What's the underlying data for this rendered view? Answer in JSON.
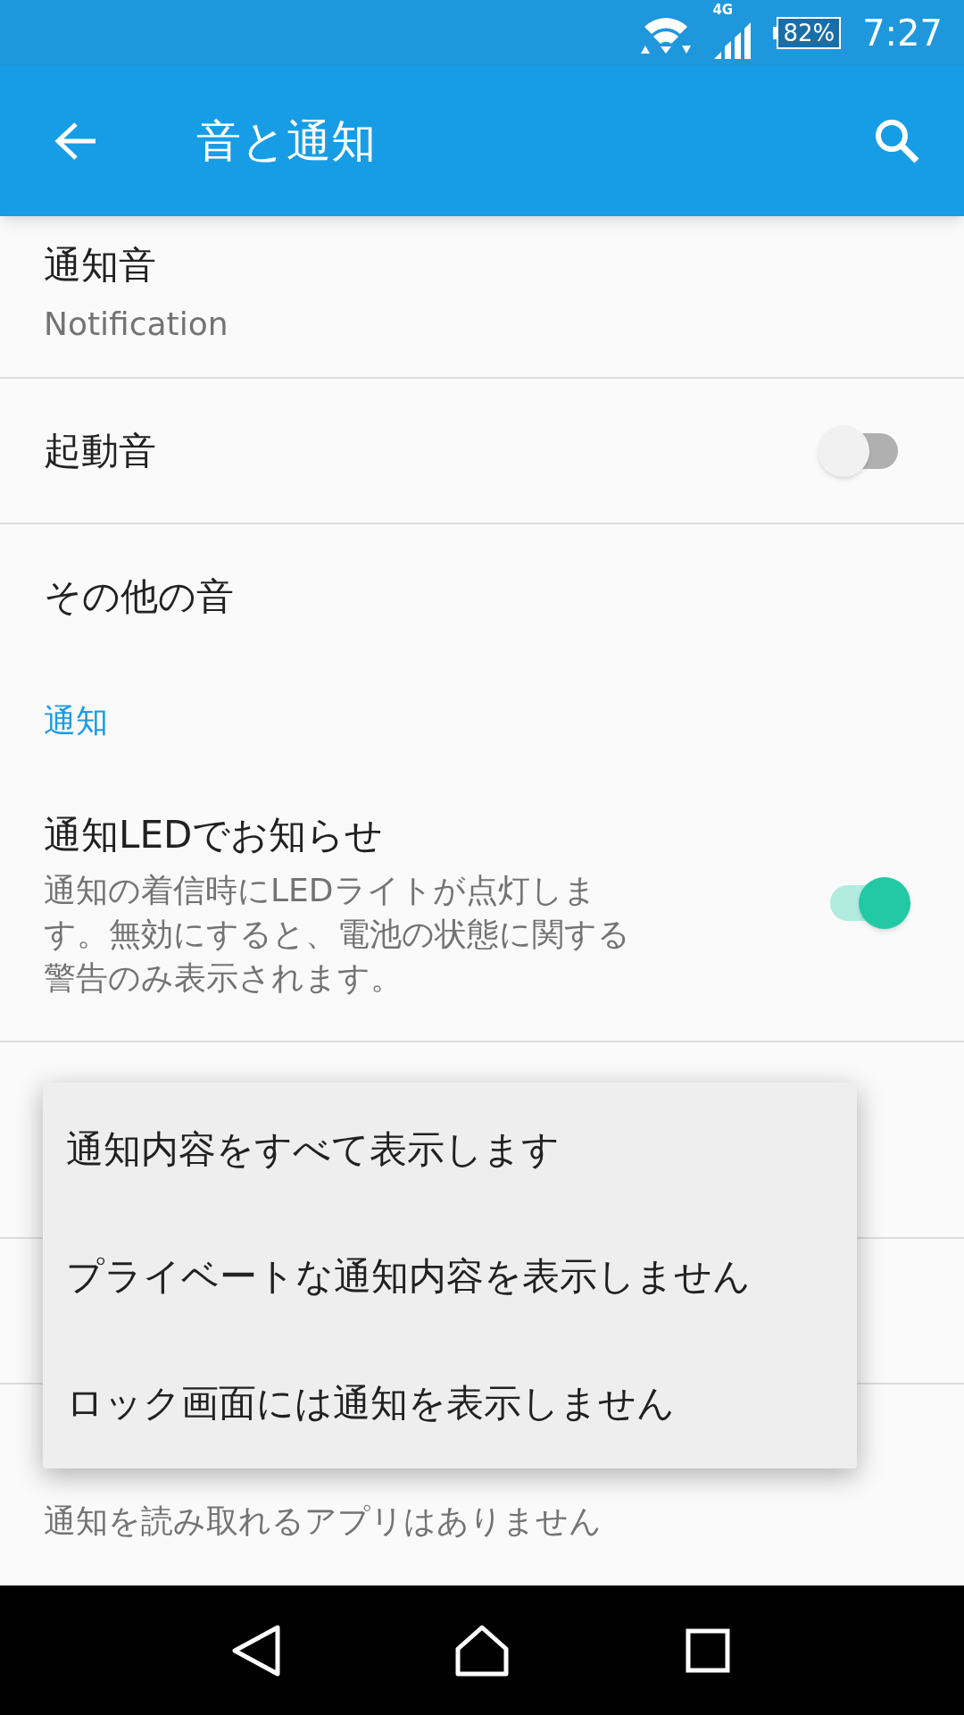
{
  "status_bar": {
    "network": "4G",
    "battery": "82%",
    "time": "7:27"
  },
  "app_bar": {
    "title": "音と通知"
  },
  "settings": [
    {
      "kind": "detail",
      "title": "通知音",
      "summary": "Notification"
    },
    {
      "kind": "switch",
      "title": "起動音",
      "on": false
    },
    {
      "kind": "plain",
      "title": "その他の音"
    },
    {
      "kind": "header",
      "title": "通知"
    },
    {
      "kind": "switch",
      "title": "通知LEDでお知らせ",
      "summary": "通知の着信時にLEDライトが点灯します。無効にすると、電池の状態に関する警告のみ表示されます。",
      "on": true
    },
    {
      "kind": "hidden"
    },
    {
      "kind": "hidden"
    },
    {
      "kind": "detail",
      "summary": "通知を読み取れるアプリはありません"
    }
  ],
  "popup_menu": [
    "通知内容をすべて表示します",
    "プライベートな通知内容を表示しません",
    "ロック画面には通知を表示しません"
  ]
}
